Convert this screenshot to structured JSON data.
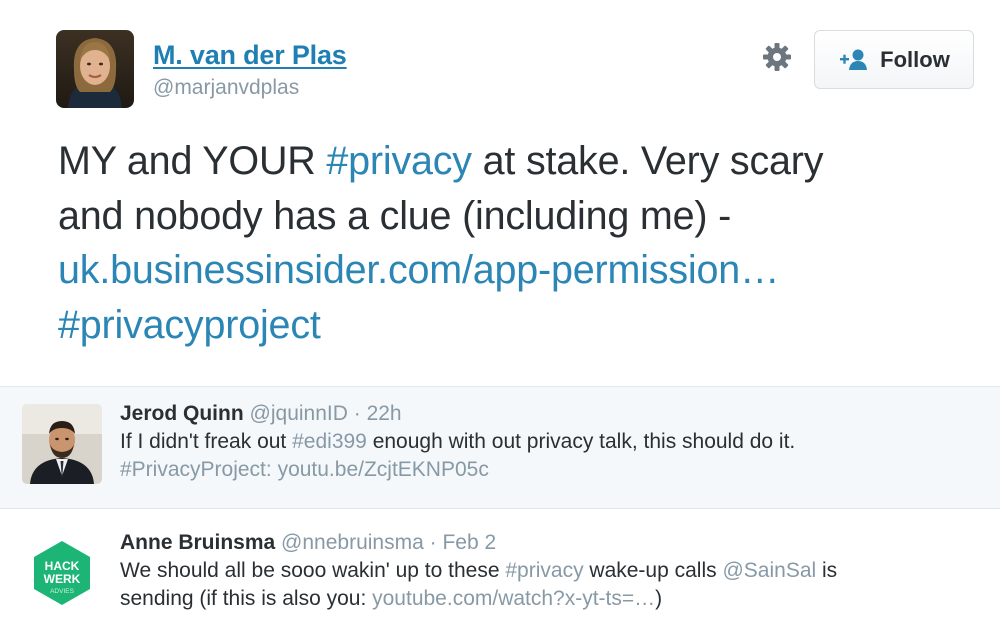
{
  "tweet": {
    "author_name": "M. van der Plas",
    "author_handle": "@marjanvdplas",
    "follow_label": "Follow",
    "lines": [
      {
        "a": "MY and YOUR ",
        "h1": "#privacy",
        "b": " at stake. Very scary"
      },
      {
        "text": "and nobody has a clue (including me)  -"
      },
      {
        "link": "uk.businessinsider.com/app-permission…"
      },
      {
        "tag": "#privacyproject"
      }
    ]
  },
  "replies": [
    {
      "name": "Jerod Quinn",
      "handle": "@jquinnID",
      "sep": " · ",
      "time": "22h",
      "line1": {
        "a": "If I didn't freak out ",
        "tag": "#edi399",
        "b": " enough with out privacy talk, this should do it."
      },
      "line2": {
        "tag": "#PrivacyProject:",
        "link": "youtu.be/ZcjtEKNP05c"
      }
    },
    {
      "name": "Anne Bruinsma",
      "handle": "@nnebruinsma",
      "sep": " · ",
      "time": "Feb 2",
      "avatar_text": [
        "HACK",
        "WERK",
        "ADVIES"
      ],
      "line1": {
        "a": "We should all be sooo wakin' up to these ",
        "tag": "#privacy",
        "b": " wake-up calls ",
        "mention": "@SainSal",
        "c": " is"
      },
      "line2": {
        "a": "sending (if this is also you: ",
        "link": "youtube.com/watch?x-yt-ts=…",
        "b": ")"
      }
    }
  ],
  "colors": {
    "link": "#2b86b5",
    "name_link": "#1f7fb2",
    "muted": "#8899a6",
    "text": "#292f33",
    "hackwerk": "#1db575"
  },
  "icons": {
    "settings": "gear-icon",
    "follow": "add-user-icon"
  }
}
